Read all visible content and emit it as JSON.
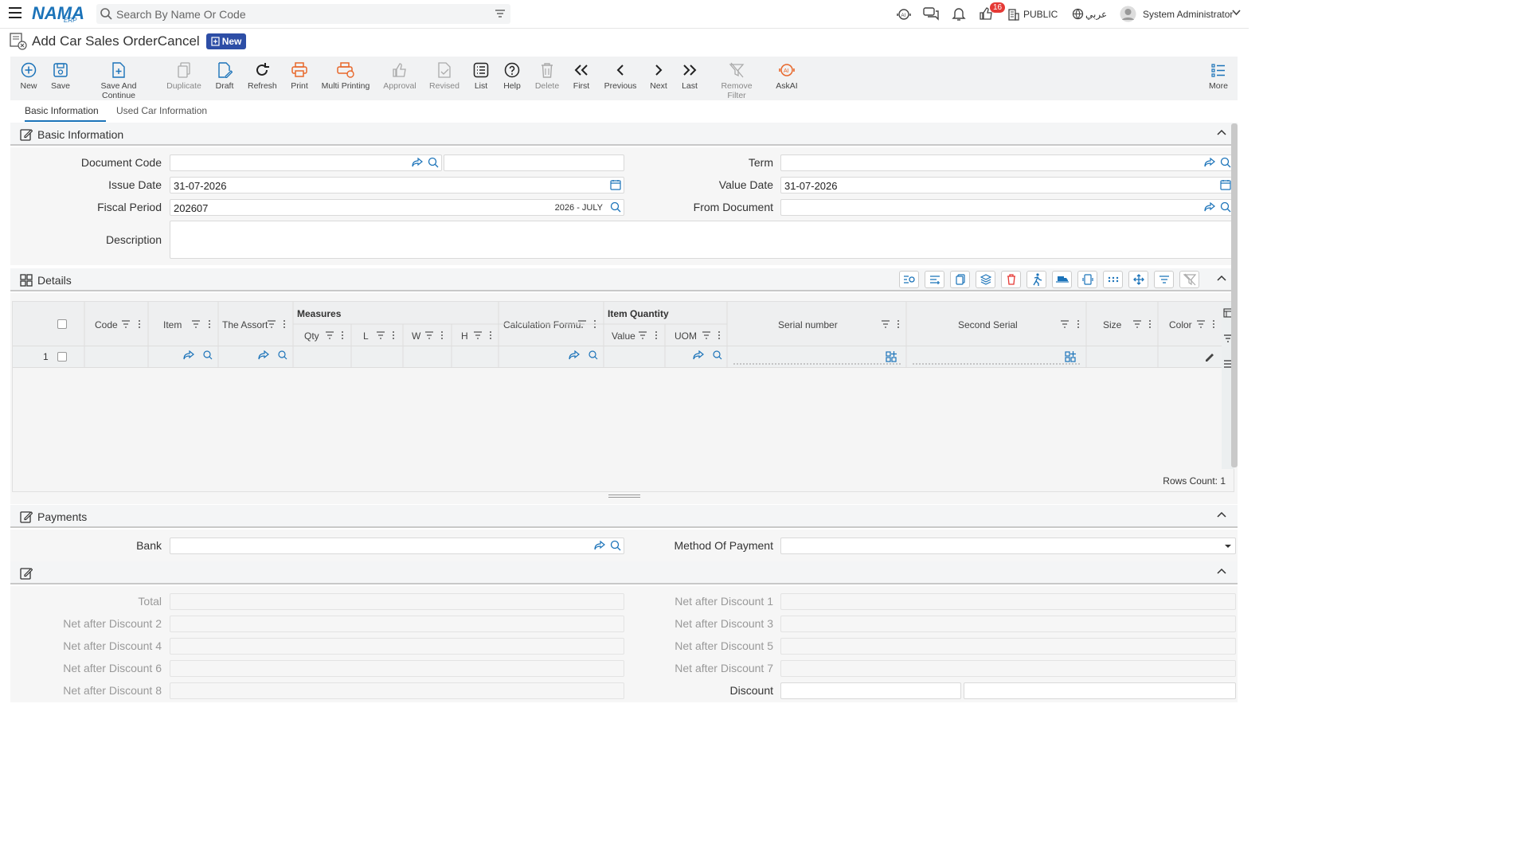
{
  "topbar": {
    "logo": "NAMA",
    "logo_sub": "ERP",
    "search_placeholder": "Search By Name Or Code",
    "notification_count": "16",
    "company": "PUBLIC",
    "language": "عربي",
    "user": "System Administrator"
  },
  "page": {
    "title": "Add Car Sales OrderCancel",
    "status_badge": "New"
  },
  "toolbar": {
    "buttons": [
      {
        "label": "New",
        "icon": "plus-circle-icon"
      },
      {
        "label": "Save",
        "icon": "save-icon"
      },
      {
        "label": "Save And Continue",
        "icon": "save-continue-icon"
      },
      {
        "label": "Duplicate",
        "icon": "duplicate-icon"
      },
      {
        "label": "Draft",
        "icon": "draft-icon"
      },
      {
        "label": "Refresh",
        "icon": "refresh-icon"
      },
      {
        "label": "Print",
        "icon": "print-icon"
      },
      {
        "label": "Multi Printing",
        "icon": "multi-print-icon"
      },
      {
        "label": "Approval",
        "icon": "thumbs-up-icon"
      },
      {
        "label": "Revised",
        "icon": "revised-icon"
      },
      {
        "label": "List",
        "icon": "list-icon"
      },
      {
        "label": "Help",
        "icon": "help-icon"
      },
      {
        "label": "Delete",
        "icon": "trash-icon"
      },
      {
        "label": "First",
        "icon": "double-chevron-left-icon"
      },
      {
        "label": "Previous",
        "icon": "chevron-left-icon"
      },
      {
        "label": "Next",
        "icon": "chevron-right-icon"
      },
      {
        "label": "Last",
        "icon": "double-chevron-right-icon"
      },
      {
        "label": "Remove Filter",
        "icon": "remove-filter-icon"
      },
      {
        "label": "AskAI",
        "icon": "ai-icon"
      },
      {
        "label": "More",
        "icon": "more-list-icon"
      }
    ]
  },
  "tabs": [
    {
      "label": "Basic Information",
      "active": true
    },
    {
      "label": "Used Car Information",
      "active": false
    }
  ],
  "basic_info": {
    "title": "Basic Information",
    "document_code_label": "Document Code",
    "document_code_value": "",
    "issue_date_label": "Issue Date",
    "issue_date_value": "31-07-2026",
    "fiscal_period_label": "Fiscal Period",
    "fiscal_period_value": "202607",
    "fiscal_period_desc": "2026 - JULY",
    "description_label": "Description",
    "term_label": "Term",
    "value_date_label": "Value Date",
    "value_date_value": "31-07-2026",
    "from_document_label": "From Document"
  },
  "details": {
    "title": "Details",
    "columns": {
      "code": "Code",
      "item": "Item",
      "assort": "The Assort",
      "measures": "Measures",
      "qty": "Qty",
      "l": "L",
      "w": "W",
      "h": "H",
      "calc": "Calculation Formu",
      "item_quantity": "Item Quantity",
      "value": "Value",
      "uom": "UOM",
      "serial": "Serial number",
      "second_serial": "Second Serial",
      "size": "Size",
      "color": "Color"
    },
    "rows": [
      {
        "num": "1"
      }
    ],
    "rows_count": "Rows Count: 1"
  },
  "payments": {
    "title": "Payments",
    "bank_label": "Bank",
    "method_label": "Method Of Payment"
  },
  "totals": {
    "total": "Total",
    "nd1": "Net after Discount 1",
    "nd2": "Net after Discount 2",
    "nd3": "Net after Discount 3",
    "nd4": "Net after Discount 4",
    "nd5": "Net after Discount 5",
    "nd6": "Net after Discount 6",
    "nd7": "Net after Discount 7",
    "nd8": "Net after Discount 8",
    "discount": "Discount"
  },
  "colors": {
    "accent": "#1b73b9",
    "badge_red": "#e53935",
    "status_blue": "#2d4ea6",
    "print_orange": "#e8672a"
  }
}
